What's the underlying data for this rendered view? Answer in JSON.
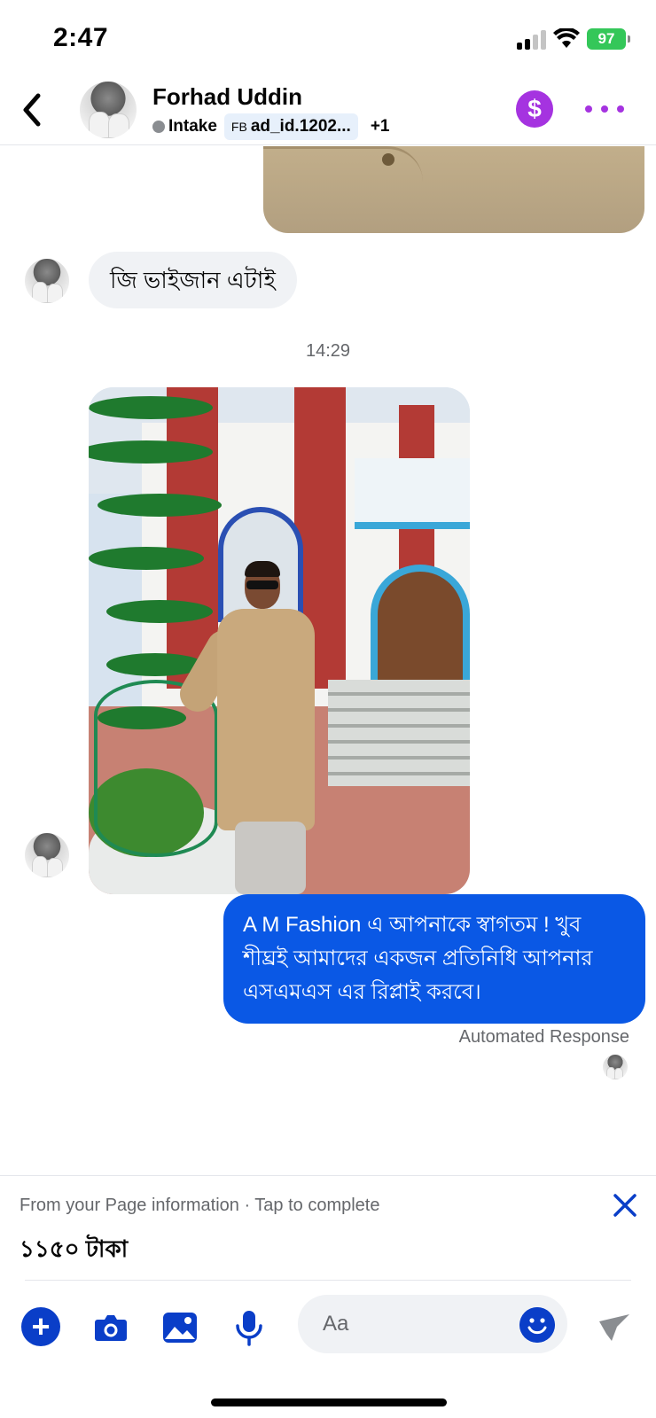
{
  "status_bar": {
    "time": "2:47",
    "battery": "97"
  },
  "header": {
    "contact_name": "Forhad Uddin",
    "stage": "Intake",
    "tag_prefix": "FB",
    "tag": "ad_id.1202...",
    "more_tags": "+1",
    "payment_icon": "$"
  },
  "messages": {
    "incoming_text": "জি ভাইজান এটাই",
    "timestamp": "14:29",
    "outgoing_text": "A M Fashion এ আপনাকে স্বাগতম ! খুব শীঘ্রই আমাদের একজন প্রতিনিধি আপনার এসএমএস এর রিপ্লাই করবে।",
    "outgoing_label": "Automated Response"
  },
  "info_card": {
    "hint": "From your Page information · Tap to complete",
    "value": "১১৫০ টাকা"
  },
  "composer": {
    "placeholder": "Aa",
    "plus_label": "+"
  },
  "colors": {
    "accent_blue": "#0a58e5",
    "icon_blue": "#0a3ec8",
    "purple": "#a533e0",
    "battery_green": "#34c759"
  },
  "icons": [
    "back-icon",
    "dollar-icon",
    "more-icon",
    "close-icon",
    "plus-icon",
    "camera-icon",
    "gallery-icon",
    "microphone-icon",
    "emoji-icon",
    "like-icon"
  ]
}
